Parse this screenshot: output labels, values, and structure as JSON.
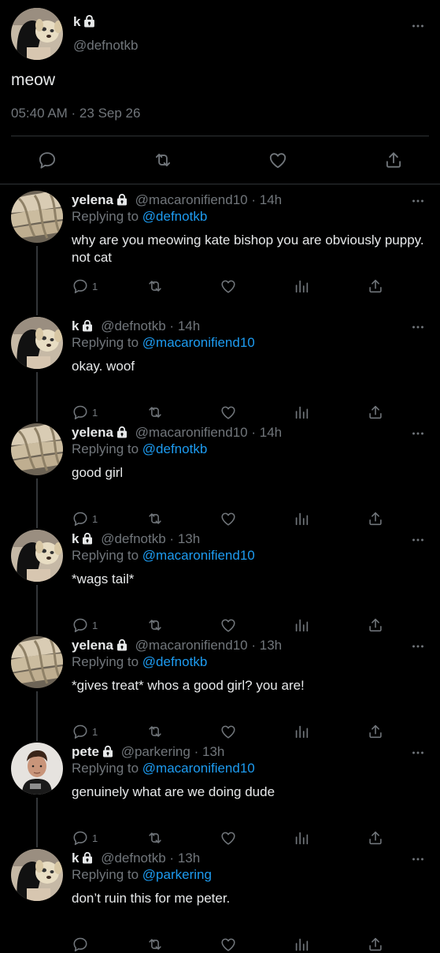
{
  "main_tweet": {
    "name": "k",
    "handle": "@defnotkb",
    "text": "meow",
    "timestamp": "05:40 AM · 23 Sep 26"
  },
  "replies": [
    {
      "name": "yelena",
      "handle": "@macaronifiend10",
      "sep": "·",
      "time": "14h",
      "replying_label": "Replying to",
      "replying_to": "@defnotkb",
      "text": "why are you meowing kate bishop you are obviously puppy. not cat",
      "reply_count": "1"
    },
    {
      "name": "k",
      "handle": "@defnotkb",
      "sep": "·",
      "time": "14h",
      "replying_label": "Replying to",
      "replying_to": "@macaronifiend10",
      "text": "okay. woof",
      "reply_count": "1"
    },
    {
      "name": "yelena",
      "handle": "@macaronifiend10",
      "sep": "·",
      "time": "14h",
      "replying_label": "Replying to",
      "replying_to": "@defnotkb",
      "text": "good girl",
      "reply_count": "1"
    },
    {
      "name": "k",
      "handle": "@defnotkb",
      "sep": "·",
      "time": "13h",
      "replying_label": "Replying to",
      "replying_to": "@macaronifiend10",
      "text": "*wags tail*",
      "reply_count": "1"
    },
    {
      "name": "yelena",
      "handle": "@macaronifiend10",
      "sep": "·",
      "time": "13h",
      "replying_label": "Replying to",
      "replying_to": "@defnotkb",
      "text": "*gives treat* whos a good girl? you are!",
      "reply_count": "1"
    },
    {
      "name": "pete",
      "handle": "@parkering",
      "sep": "·",
      "time": "13h",
      "replying_label": "Replying to",
      "replying_to": "@macaronifiend10",
      "text": "genuinely what are we doing dude",
      "reply_count": "1"
    },
    {
      "name": "k",
      "handle": "@defnotkb",
      "sep": "·",
      "time": "13h",
      "replying_label": "Replying to",
      "replying_to": "@parkering",
      "text": "don’t ruin this for me peter.",
      "reply_count": ""
    }
  ],
  "colors": {
    "background": "#000000",
    "text": "#e7e9ea",
    "muted": "#71767b",
    "link": "#1d9bf0",
    "divider": "#2f3336"
  }
}
